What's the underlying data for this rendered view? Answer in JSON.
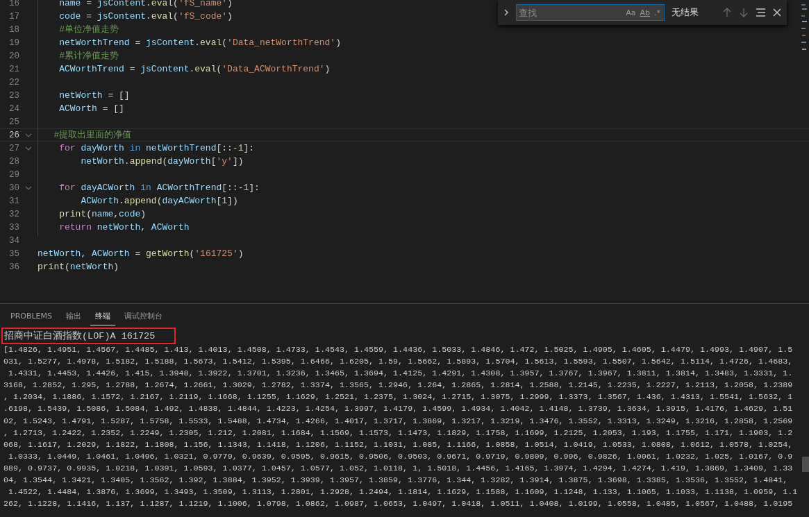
{
  "editor": {
    "lines": [
      {
        "number": "16",
        "current": false,
        "foldable": false,
        "tokens": [
          {
            "t": "    name",
            "kind": "var"
          },
          {
            "t": " = ",
            "kind": "plain"
          },
          {
            "t": "jsContent",
            "kind": "var"
          },
          {
            "t": ".",
            "kind": "plain"
          },
          {
            "t": "eval",
            "kind": "fn"
          },
          {
            "t": "(",
            "kind": "plain"
          },
          {
            "t": "'fS_name'",
            "kind": "str"
          },
          {
            "t": ")",
            "kind": "plain"
          }
        ]
      },
      {
        "number": "17",
        "current": false,
        "foldable": false,
        "tokens": [
          {
            "t": "    code",
            "kind": "var"
          },
          {
            "t": " = ",
            "kind": "plain"
          },
          {
            "t": "jsContent",
            "kind": "var"
          },
          {
            "t": ".",
            "kind": "plain"
          },
          {
            "t": "eval",
            "kind": "fn"
          },
          {
            "t": "(",
            "kind": "plain"
          },
          {
            "t": "'fS_code'",
            "kind": "str"
          },
          {
            "t": ")",
            "kind": "plain"
          }
        ]
      },
      {
        "number": "18",
        "current": false,
        "foldable": false,
        "tokens": [
          {
            "t": "    #单位净值走势",
            "kind": "comment"
          }
        ]
      },
      {
        "number": "19",
        "current": false,
        "foldable": false,
        "tokens": [
          {
            "t": "    netWorthTrend",
            "kind": "var"
          },
          {
            "t": " = ",
            "kind": "plain"
          },
          {
            "t": "jsContent",
            "kind": "var"
          },
          {
            "t": ".",
            "kind": "plain"
          },
          {
            "t": "eval",
            "kind": "fn"
          },
          {
            "t": "(",
            "kind": "plain"
          },
          {
            "t": "'Data_netWorthTrend'",
            "kind": "str"
          },
          {
            "t": ")",
            "kind": "plain"
          }
        ]
      },
      {
        "number": "20",
        "current": false,
        "foldable": false,
        "tokens": [
          {
            "t": "    #累计净值走势",
            "kind": "comment"
          }
        ]
      },
      {
        "number": "21",
        "current": false,
        "foldable": false,
        "tokens": [
          {
            "t": "    ACWorthTrend",
            "kind": "var"
          },
          {
            "t": " = ",
            "kind": "plain"
          },
          {
            "t": "jsContent",
            "kind": "var"
          },
          {
            "t": ".",
            "kind": "plain"
          },
          {
            "t": "eval",
            "kind": "fn"
          },
          {
            "t": "(",
            "kind": "plain"
          },
          {
            "t": "'Data_ACWorthTrend'",
            "kind": "str"
          },
          {
            "t": ")",
            "kind": "plain"
          }
        ]
      },
      {
        "number": "22",
        "current": false,
        "foldable": false
      },
      {
        "number": "23",
        "current": false,
        "foldable": false,
        "tokens": [
          {
            "t": "    netWorth",
            "kind": "var"
          },
          {
            "t": " = []",
            "kind": "plain"
          }
        ]
      },
      {
        "number": "24",
        "current": false,
        "foldable": false,
        "tokens": [
          {
            "t": "    ACWorth",
            "kind": "var"
          },
          {
            "t": " = []",
            "kind": "plain"
          }
        ]
      },
      {
        "number": "25",
        "current": false,
        "foldable": false
      },
      {
        "number": "26",
        "current": true,
        "foldable": true,
        "tokens": [
          {
            "t": "   #提取出里面的净值",
            "kind": "comment"
          }
        ]
      },
      {
        "number": "27",
        "current": false,
        "foldable": true,
        "tokens": [
          {
            "t": "    for",
            "kind": "kw"
          },
          {
            "t": " dayWorth",
            "kind": "var"
          },
          {
            "t": " in",
            "kind": "op"
          },
          {
            "t": " netWorthTrend",
            "kind": "var"
          },
          {
            "t": "[::-",
            "kind": "plain"
          },
          {
            "t": "1",
            "kind": "num"
          },
          {
            "t": "]:",
            "kind": "plain"
          }
        ]
      },
      {
        "number": "28",
        "current": false,
        "foldable": false,
        "tokens": [
          {
            "t": "        netWorth",
            "kind": "var"
          },
          {
            "t": ".",
            "kind": "plain"
          },
          {
            "t": "append",
            "kind": "fn"
          },
          {
            "t": "(",
            "kind": "plain"
          },
          {
            "t": "dayWorth",
            "kind": "var"
          },
          {
            "t": "[",
            "kind": "plain"
          },
          {
            "t": "'y'",
            "kind": "str"
          },
          {
            "t": "])",
            "kind": "plain"
          }
        ]
      },
      {
        "number": "29",
        "current": false,
        "foldable": false
      },
      {
        "number": "30",
        "current": false,
        "foldable": true,
        "tokens": [
          {
            "t": "    for",
            "kind": "kw"
          },
          {
            "t": " dayACWorth",
            "kind": "var"
          },
          {
            "t": " in",
            "kind": "op"
          },
          {
            "t": " ACWorthTrend",
            "kind": "var"
          },
          {
            "t": "[::-",
            "kind": "plain"
          },
          {
            "t": "1",
            "kind": "num"
          },
          {
            "t": "]:",
            "kind": "plain"
          }
        ]
      },
      {
        "number": "31",
        "current": false,
        "foldable": false,
        "tokens": [
          {
            "t": "        ACWorth",
            "kind": "var"
          },
          {
            "t": ".",
            "kind": "plain"
          },
          {
            "t": "append",
            "kind": "fn"
          },
          {
            "t": "(",
            "kind": "plain"
          },
          {
            "t": "dayACWorth",
            "kind": "var"
          },
          {
            "t": "[",
            "kind": "plain"
          },
          {
            "t": "1",
            "kind": "num"
          },
          {
            "t": "])",
            "kind": "plain"
          }
        ]
      },
      {
        "number": "32",
        "current": false,
        "foldable": false,
        "tokens": [
          {
            "t": "    print",
            "kind": "fn"
          },
          {
            "t": "(",
            "kind": "plain"
          },
          {
            "t": "name",
            "kind": "var"
          },
          {
            "t": ",",
            "kind": "plain"
          },
          {
            "t": "code",
            "kind": "var"
          },
          {
            "t": ")",
            "kind": "plain"
          }
        ]
      },
      {
        "number": "33",
        "current": false,
        "foldable": false,
        "tokens": [
          {
            "t": "    return",
            "kind": "kw"
          },
          {
            "t": " netWorth",
            "kind": "var"
          },
          {
            "t": ", ",
            "kind": "plain"
          },
          {
            "t": "ACWorth",
            "kind": "var"
          }
        ]
      },
      {
        "number": "34",
        "current": false,
        "foldable": false
      },
      {
        "number": "35",
        "current": false,
        "foldable": false,
        "tokens": [
          {
            "t": "netWorth",
            "kind": "var"
          },
          {
            "t": ", ",
            "kind": "plain"
          },
          {
            "t": "ACWorth",
            "kind": "var"
          },
          {
            "t": " = ",
            "kind": "plain"
          },
          {
            "t": "getWorth",
            "kind": "fn"
          },
          {
            "t": "(",
            "kind": "plain"
          },
          {
            "t": "'161725'",
            "kind": "str"
          },
          {
            "t": ")",
            "kind": "plain"
          }
        ]
      },
      {
        "number": "36",
        "current": false,
        "foldable": false,
        "tokens": [
          {
            "t": "print",
            "kind": "fn"
          },
          {
            "t": "(",
            "kind": "plain"
          },
          {
            "t": "netWorth",
            "kind": "var"
          },
          {
            "t": ")",
            "kind": "plain"
          }
        ]
      }
    ]
  },
  "find_widget": {
    "placeholder": "查找",
    "options": [
      {
        "label": "Aa",
        "on": false
      },
      {
        "label": "Ab",
        "on": false
      },
      {
        "label": ".*",
        "on": false
      }
    ],
    "result": "无结果"
  },
  "panel": {
    "tabs": [
      {
        "label": "PROBLEMS",
        "selected": false
      },
      {
        "label": "输出",
        "selected": false
      },
      {
        "label": "终端",
        "selected": true
      },
      {
        "label": "调试控制台",
        "selected": false
      }
    ],
    "terminal": {
      "header": {
        "text": "招商中证白酒指数(LOF)A 161725",
        "boxed": true
      },
      "lines": [
        "[1.4826, 1.4951, 1.4567, 1.4485, 1.413, 1.4013, 1.4508, 1.4733, 1.4543, 1.4559, 1.4436, 1.5033, 1.4846, 1.472, 1.5025, 1.4905, 1.4605, 1.4479, 1.4993, 1.4907, 1.5",
        "031, 1.5277, 1.4978, 1.5182, 1.5188, 1.5673, 1.5412, 1.5395, 1.6466, 1.6205, 1.59, 1.5662, 1.5893, 1.5704, 1.5613, 1.5593, 1.5507, 1.5642, 1.5114, 1.4726, 1.4683,",
        " 1.4331, 1.4453, 1.4426, 1.415, 1.3948, 1.3922, 1.3701, 1.3236, 1.3465, 1.3694, 1.4125, 1.4291, 1.4308, 1.3957, 1.3767, 1.3967, 1.3811, 1.3814, 1.3483, 1.3331, 1.",
        "3168, 1.2852, 1.295, 1.2788, 1.2674, 1.2661, 1.3029, 1.2782, 1.3374, 1.3565, 1.2946, 1.264, 1.2865, 1.2814, 1.2588, 1.2145, 1.2235, 1.2227, 1.2113, 1.2058, 1.2389",
        ", 1.2034, 1.1886, 1.1572, 1.2167, 1.2119, 1.1668, 1.1255, 1.1629, 1.2521, 1.2375, 1.3024, 1.2715, 1.3075, 1.2999, 1.3373, 1.3567, 1.436, 1.4313, 1.5541, 1.5632, 1",
        ".6198, 1.5439, 1.5086, 1.5084, 1.492, 1.4838, 1.4844, 1.4223, 1.4254, 1.3997, 1.4179, 1.4599, 1.4934, 1.4042, 1.4148, 1.3739, 1.3634, 1.3915, 1.4176, 1.4629, 1.51",
        "02, 1.5243, 1.4791, 1.5287, 1.5758, 1.5533, 1.5488, 1.4734, 1.4266, 1.4017, 1.3717, 1.3869, 1.3217, 1.3219, 1.3476, 1.3552, 1.3313, 1.3249, 1.3216, 1.2858, 1.2569",
        ", 1.2713, 1.2422, 1.2352, 1.2249, 1.2305, 1.212, 1.2081, 1.1684, 1.1569, 1.1573, 1.1473, 1.1829, 1.1758, 1.1699, 1.2125, 1.2053, 1.193, 1.1755, 1.171, 1.1903, 1.2",
        "068, 1.1617, 1.2029, 1.1822, 1.1808, 1.156, 1.1343, 1.1418, 1.1206, 1.1152, 1.1031, 1.085, 1.1166, 1.0858, 1.0514, 1.0419, 1.0533, 1.0808, 1.0612, 1.0578, 1.0254,",
        " 1.0333, 1.0449, 1.0461, 1.0496, 1.0321, 0.9779, 0.9639, 0.9595, 0.9615, 0.9506, 0.9503, 0.9671, 0.9719, 0.9809, 0.996, 0.9826, 1.0061, 1.0232, 1.025, 1.0167, 0.9",
        "889, 0.9737, 0.9935, 1.0218, 1.0391, 1.0593, 1.0377, 1.0457, 1.0577, 1.052, 1.0118, 1, 1.5018, 1.4456, 1.4165, 1.3974, 1.4294, 1.4274, 1.419, 1.3869, 1.3409, 1.33",
        "04, 1.3544, 1.3421, 1.3405, 1.3562, 1.392, 1.3884, 1.3952, 1.3939, 1.3957, 1.3859, 1.3776, 1.344, 1.3282, 1.3914, 1.3875, 1.3698, 1.3385, 1.3536, 1.3552, 1.4841,",
        " 1.4522, 1.4484, 1.3876, 1.3699, 1.3493, 1.3509, 1.3113, 1.2801, 1.2928, 1.2494, 1.1814, 1.1629, 1.1588, 1.1609, 1.1248, 1.133, 1.1065, 1.1033, 1.1138, 1.0959, 1.1",
        "262, 1.1228, 1.1416, 1.137, 1.1287, 1.1219, 1.1006, 1.0798, 1.0862, 1.0987, 1.0653, 1.0497, 1.0418, 1.0511, 1.0408, 1.0199, 1.0558, 1.0485, 1.0567, 1.0488, 1.0195"
      ]
    }
  }
}
